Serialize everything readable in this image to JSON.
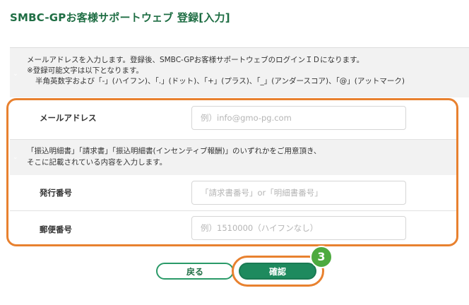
{
  "page": {
    "title": "SMBC-GPお客様サポートウェブ 登録[入力]"
  },
  "notice": {
    "line1": "メールアドレスを入力します。登録後、SMBC-GPお客様サポートウェブのログインＩＤになります。",
    "line2": "※登録可能文字は以下となります。",
    "line3": "半角英数字および「-」(ハイフン)、「.」(ドット)、「+」(プラス)、「_」(アンダースコア)、「@」(アットマーク)"
  },
  "email": {
    "label": "メールアドレス",
    "placeholder": "例）info@gmo-pg.com",
    "value": ""
  },
  "invoice_note": {
    "line1": "「振込明細書」「請求書」「振込明細書(インセンティブ報酬)」のいずれかをご用意頂き、",
    "line2": "そこに記載されている内容を入力します。"
  },
  "issue_number": {
    "label": "発行番号",
    "placeholder": "「請求書番号」or「明細書番号」",
    "value": ""
  },
  "postal_code": {
    "label": "郵便番号",
    "placeholder": "例）1510000（ハイフンなし）",
    "value": ""
  },
  "buttons": {
    "back": "戻る",
    "confirm": "確認"
  },
  "step_badge": "3",
  "colors": {
    "brand_green": "#1e8a5e",
    "title_green": "#1f6e44",
    "highlight_orange": "#e8812f",
    "badge_green": "#4daa3f"
  }
}
